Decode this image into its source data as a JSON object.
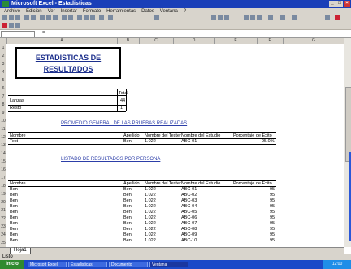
{
  "window": {
    "title": "Microsoft Excel - Estadisticas"
  },
  "menu": [
    "Archivo",
    "Edicion",
    "Ver",
    "Insertar",
    "Formato",
    "Herramientas",
    "Datos",
    "Ventana",
    "?"
  ],
  "namebox": "",
  "title_box": {
    "line1": "ESTADISTICAS DE",
    "line2": "RESULTADOS"
  },
  "small_table": {
    "header": "Total",
    "rows": [
      {
        "label": "Lanzas",
        "value": "44"
      },
      {
        "label": "Resto",
        "value": "1"
      }
    ]
  },
  "section1": {
    "heading": "PROMEDIO GENERAL DE LAS PRUEBAS REALIZADAS",
    "columns": [
      "Nombre",
      "Apellido",
      "Nombre del Tester",
      "Nombre del Estudio",
      "Porcentaje de Exito"
    ],
    "row": [
      "Test",
      "Ben",
      "1.022",
      "ABC-01",
      "95.0%"
    ]
  },
  "section2": {
    "heading": "LISTADO DE RESULTADOS POR PERSONA",
    "columns": [
      "Nombre",
      "Apellido",
      "Nombre del Tester",
      "Nombre del Estudio",
      "Porcentaje de Exito"
    ],
    "rows": [
      [
        "Ben",
        "Ben",
        "1.022",
        "ABC-01",
        "95"
      ],
      [
        "Ben",
        "Ben",
        "1.022",
        "ABC-02",
        "95"
      ],
      [
        "Ben",
        "Ben",
        "1.022",
        "ABC-03",
        "95"
      ],
      [
        "Ben",
        "Ben",
        "1.022",
        "ABC-04",
        "95"
      ],
      [
        "Ben",
        "Ben",
        "1.022",
        "ABC-05",
        "95"
      ],
      [
        "Ben",
        "Ben",
        "1.022",
        "ABC-06",
        "95"
      ],
      [
        "Ben",
        "Ben",
        "1.022",
        "ABC-07",
        "95"
      ],
      [
        "Ben",
        "Ben",
        "1.022",
        "ABC-08",
        "95"
      ],
      [
        "Ben",
        "Ben",
        "1.022",
        "ABC-09",
        "95"
      ],
      [
        "Ben",
        "Ben",
        "1.022",
        "ABC-10",
        "95"
      ]
    ]
  },
  "sheet_tab": "Hoja1",
  "status": "Listo",
  "taskbar": {
    "start": "Inicio",
    "tasks": [
      "Microsoft Excel",
      "Estadisticas",
      "Documento",
      "Ventana"
    ],
    "clock": "12:00"
  },
  "colors": {
    "accent": "#1a3fb8",
    "heading": "#2c3ea8",
    "taskbar": "#1b49c8"
  }
}
